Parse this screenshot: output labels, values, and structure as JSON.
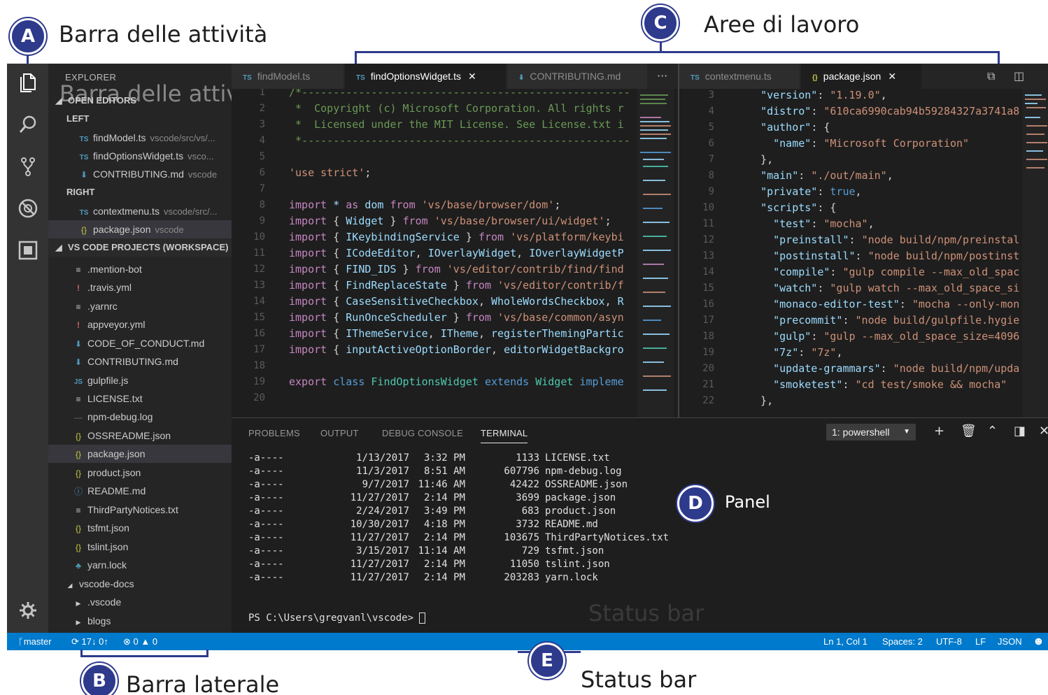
{
  "annotations": {
    "a": {
      "letter": "A",
      "label": "Barra delle attività"
    },
    "b": {
      "letter": "B",
      "label": "Barra laterale"
    },
    "c": {
      "letter": "C",
      "label": "Aree di lavoro"
    },
    "d": {
      "letter": "D",
      "label": "Panel"
    },
    "e": {
      "letter": "E",
      "label": "Status bar"
    },
    "ghost_sidebar": "Barra delle attività",
    "ghost_panel": "Status bar"
  },
  "colors": {
    "accent": "#2e3a8c",
    "statusbar": "#007acc"
  },
  "activitybar": {
    "icons": [
      "files-icon",
      "search-icon",
      "source-control-icon",
      "debug-icon",
      "extensions-icon",
      "gear-icon"
    ]
  },
  "sidebar": {
    "title": "EXPLORER",
    "open_editors_header": "OPEN EDITORS",
    "left_group": "LEFT",
    "left_items": [
      {
        "icon": "TS",
        "name": "findModel.ts",
        "desc": "vscode/src/vs/..."
      },
      {
        "icon": "TS",
        "name": "findOptionsWidget.ts",
        "desc": "vsco..."
      },
      {
        "icon": "md",
        "name": "CONTRIBUTING.md",
        "desc": "vscode"
      }
    ],
    "right_group": "RIGHT",
    "right_items": [
      {
        "icon": "TS",
        "name": "contextmenu.ts",
        "desc": "vscode/src/..."
      },
      {
        "icon": "{}",
        "name": "package.json",
        "desc": "vscode"
      }
    ],
    "workspace_header": "VS CODE PROJECTS (WORKSPACE)",
    "files": [
      {
        "icon": "≡",
        "name": ".mention-bot"
      },
      {
        "icon": "!",
        "name": ".travis.yml"
      },
      {
        "icon": "≡",
        "name": ".yarnrc"
      },
      {
        "icon": "!",
        "name": "appveyor.yml"
      },
      {
        "icon": "md",
        "name": "CODE_OF_CONDUCT.md"
      },
      {
        "icon": "md",
        "name": "CONTRIBUTING.md"
      },
      {
        "icon": "JS",
        "name": "gulpfile.js"
      },
      {
        "icon": "≡",
        "name": "LICENSE.txt"
      },
      {
        "icon": "—",
        "name": "npm-debug.log"
      },
      {
        "icon": "{}",
        "name": "OSSREADME.json"
      },
      {
        "icon": "{}",
        "name": "package.json"
      },
      {
        "icon": "{}",
        "name": "product.json"
      },
      {
        "icon": "ⓘ",
        "name": "README.md"
      },
      {
        "icon": "≡",
        "name": "ThirdPartyNotices.txt"
      },
      {
        "icon": "{}",
        "name": "tsfmt.json"
      },
      {
        "icon": "{}",
        "name": "tslint.json"
      },
      {
        "icon": "yarn",
        "name": "yarn.lock"
      }
    ],
    "docs_folder": "vscode-docs",
    "docs_children": [
      ".vscode",
      "blogs"
    ]
  },
  "editor_left": {
    "tabs": [
      "findModel.ts",
      "findOptionsWidget.ts",
      "CONTRIBUTING.md"
    ],
    "more": "···",
    "line_numbers": [
      "1",
      "2",
      "3",
      "4",
      "5",
      "6",
      "7",
      "8",
      "9",
      "10",
      "11",
      "12",
      "13",
      "14",
      "15",
      "16",
      "17",
      "18",
      "19",
      "20"
    ]
  },
  "editor_right": {
    "tabs": [
      "contextmenu.ts",
      "package.json"
    ],
    "line_numbers": [
      "3",
      "4",
      "5",
      "6",
      "7",
      "8",
      "9",
      "10",
      "11",
      "12",
      "13",
      "14",
      "15",
      "16",
      "17",
      "18",
      "19",
      "20",
      "21",
      "22"
    ]
  },
  "panel": {
    "tabs": [
      "PROBLEMS",
      "OUTPUT",
      "DEBUG CONSOLE",
      "TERMINAL"
    ],
    "terminal_select": "1: powershell",
    "rows": [
      {
        "mode": "-a----",
        "date": "1/13/2017",
        "time": "3:32 PM",
        "size": "1133",
        "name": "LICENSE.txt"
      },
      {
        "mode": "-a----",
        "date": "11/3/2017",
        "time": "8:51 AM",
        "size": "607796",
        "name": "npm-debug.log"
      },
      {
        "mode": "-a----",
        "date": "9/7/2017",
        "time": "11:46 AM",
        "size": "42422",
        "name": "OSSREADME.json"
      },
      {
        "mode": "-a----",
        "date": "11/27/2017",
        "time": "2:14 PM",
        "size": "3699",
        "name": "package.json"
      },
      {
        "mode": "-a----",
        "date": "2/24/2017",
        "time": "3:49 PM",
        "size": "683",
        "name": "product.json"
      },
      {
        "mode": "-a----",
        "date": "10/30/2017",
        "time": "4:18 PM",
        "size": "3732",
        "name": "README.md"
      },
      {
        "mode": "-a----",
        "date": "11/27/2017",
        "time": "2:14 PM",
        "size": "103675",
        "name": "ThirdPartyNotices.txt"
      },
      {
        "mode": "-a----",
        "date": "3/15/2017",
        "time": "11:14 AM",
        "size": "729",
        "name": "tsfmt.json"
      },
      {
        "mode": "-a----",
        "date": "11/27/2017",
        "time": "2:14 PM",
        "size": "11050",
        "name": "tslint.json"
      },
      {
        "mode": "-a----",
        "date": "11/27/2017",
        "time": "2:14 PM",
        "size": "203283",
        "name": "yarn.lock"
      }
    ],
    "prompt": "PS C:\\Users\\gregvanl\\vscode> "
  },
  "statusbar": {
    "branch": "master",
    "sync": "17↓ 0↑",
    "errors": "0",
    "warnings": "0",
    "position": "Ln 1, Col 1",
    "spaces": "Spaces: 2",
    "encoding": "UTF-8",
    "eol": "LF",
    "language": "JSON"
  }
}
